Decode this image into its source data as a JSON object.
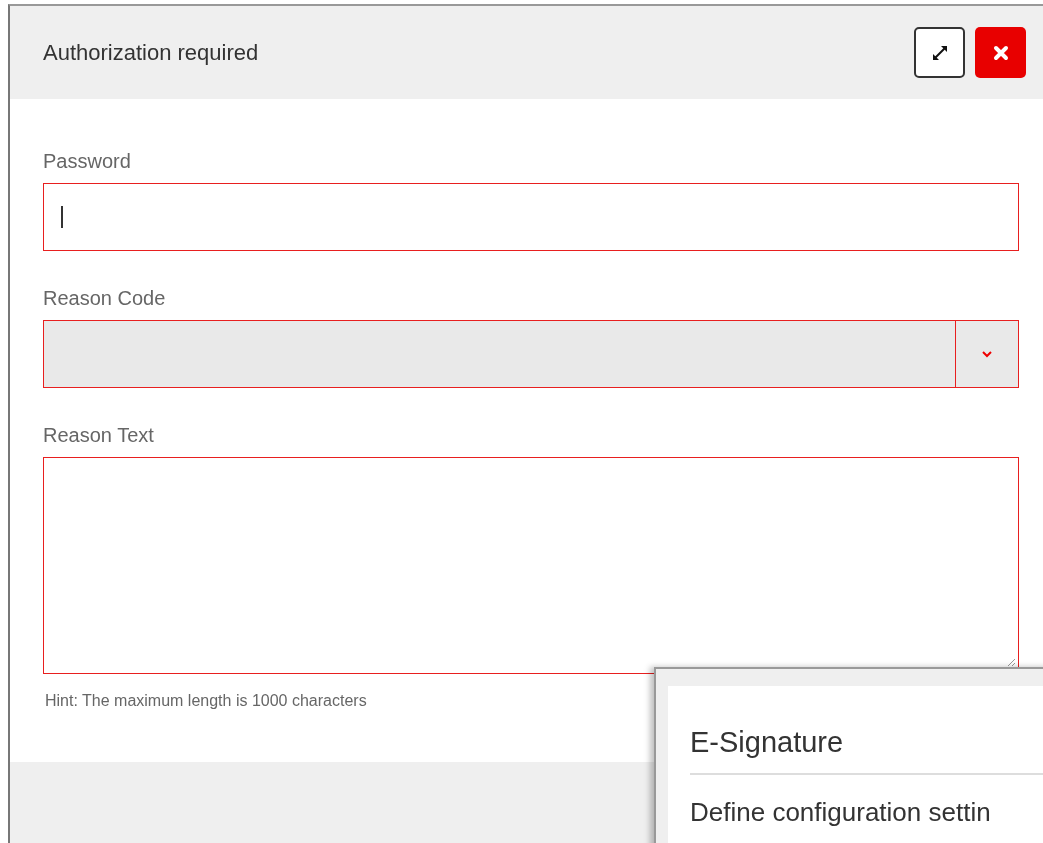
{
  "dialog": {
    "title": "Authorization required"
  },
  "fields": [
    {
      "kind": "text",
      "label": "Password",
      "invalid": true,
      "focused": true
    },
    {
      "kind": "select",
      "label": "Reason Code",
      "invalid": true,
      "focused": false
    },
    {
      "kind": "textarea",
      "label": "Reason Text",
      "invalid": true,
      "focused": false,
      "hint": "Hint: The maximum length is 1000 characters"
    }
  ],
  "overlay": {
    "title": "E-Signature",
    "text": "Define configuration settin"
  }
}
